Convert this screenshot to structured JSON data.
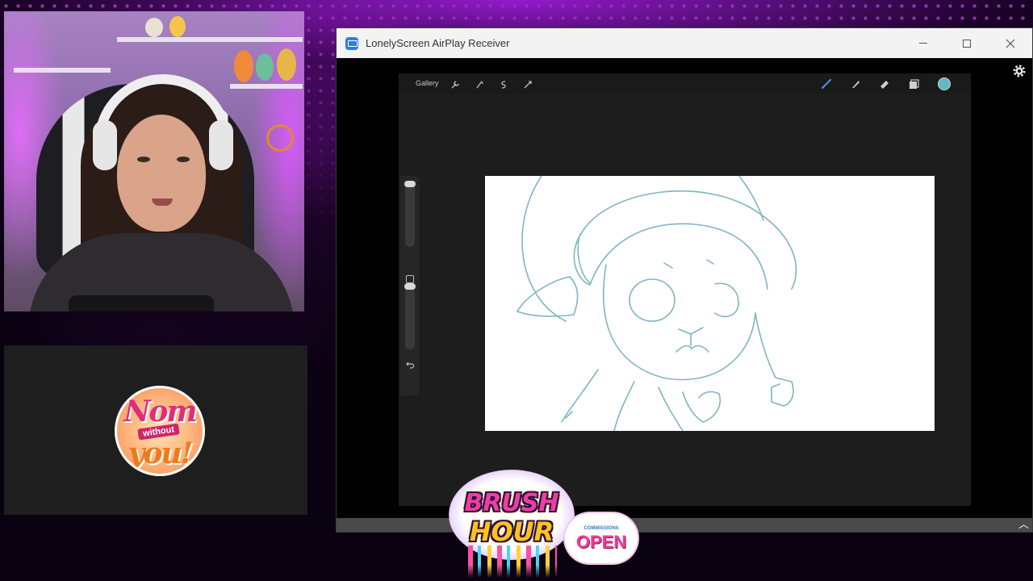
{
  "window": {
    "title": "LonelyScreen AirPlay Receiver"
  },
  "procreate": {
    "gallery_label": "Gallery",
    "left_tools": [
      "wrench-icon",
      "magic-wand-icon",
      "selection-icon",
      "transform-icon"
    ],
    "right_tools": [
      "brush-icon",
      "smudge-icon",
      "eraser-icon",
      "layers-icon"
    ],
    "current_color": "#5fb9c5"
  },
  "overlay": {
    "logo_line1": "Nom",
    "logo_line2": "without",
    "logo_line3": "you!",
    "brush_hour_line1": "BRUSH",
    "brush_hour_line2": "HOUR",
    "commissions_label": "COMMISSIONS",
    "open_label": "OPEN"
  },
  "colors": {
    "accent_purple": "#b41ee0",
    "sketch_stroke": "#7fb6c2",
    "titlebar": "#f3f3f3",
    "canvas_bg": "#ffffff"
  }
}
